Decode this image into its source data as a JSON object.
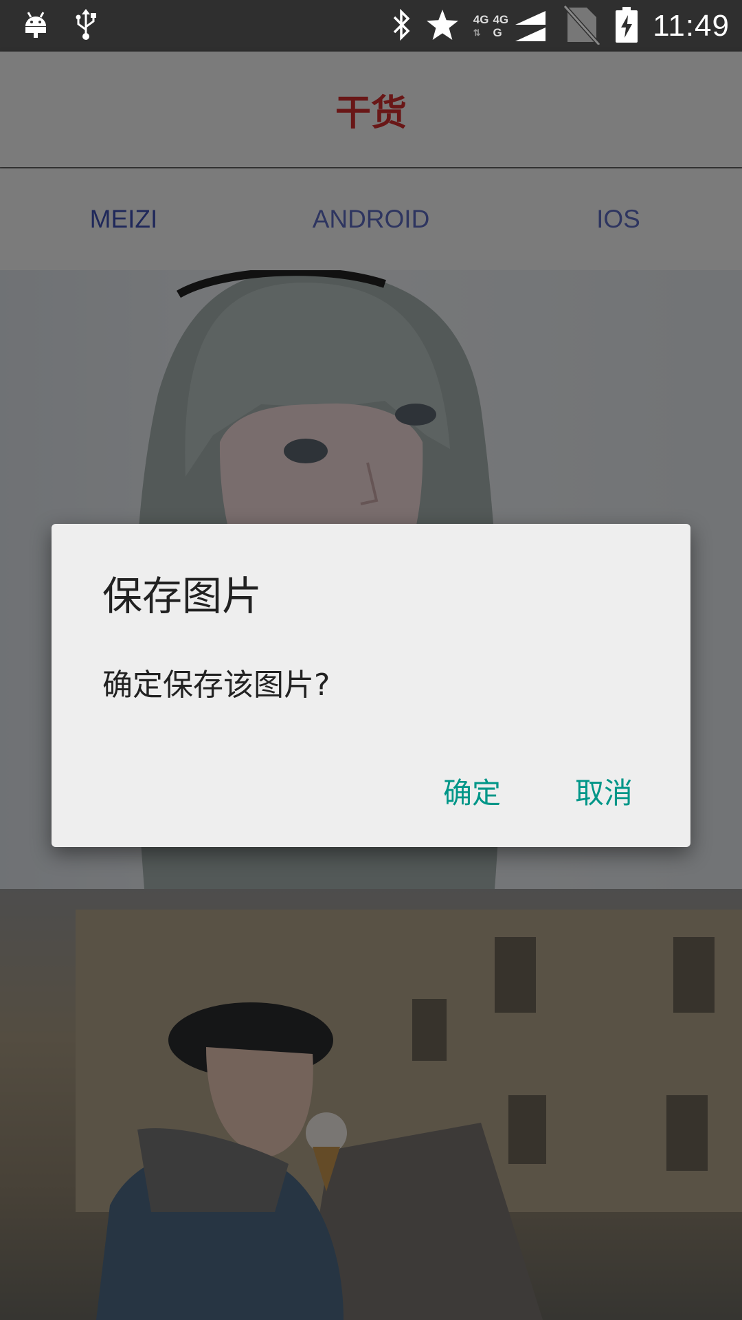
{
  "status_bar": {
    "time": "11:49",
    "network_top": "4G",
    "network_mid": "4G",
    "network_bottom": "G",
    "icons": [
      "android-debug-icon",
      "usb-icon",
      "bluetooth-icon",
      "star-icon",
      "signal-icon",
      "no-sim-icon",
      "battery-charging-icon"
    ]
  },
  "toolbar": {
    "title": "干货"
  },
  "tabs": [
    {
      "label": "MEIZI",
      "selected": true
    },
    {
      "label": "ANDROID",
      "selected": false
    },
    {
      "label": "IOS",
      "selected": false
    }
  ],
  "dialog": {
    "title": "保存图片",
    "message": "确定保存该图片?",
    "confirm_label": "确定",
    "cancel_label": "取消"
  },
  "colors": {
    "title_red": "#d32f2f",
    "tab_indigo": "#3f51b5",
    "dialog_button_teal": "#009688"
  }
}
